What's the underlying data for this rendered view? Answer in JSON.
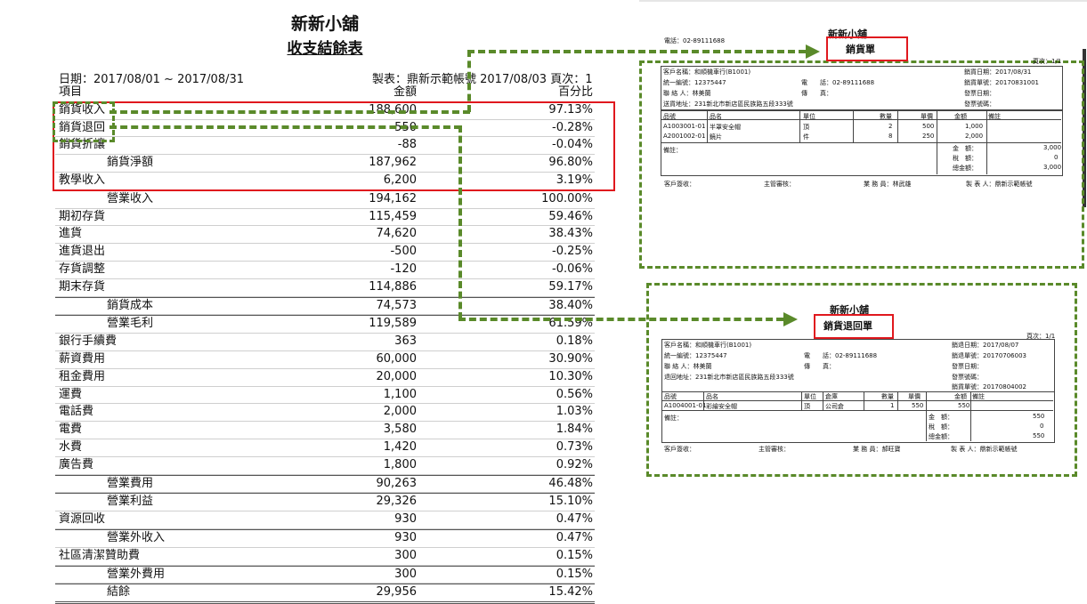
{
  "report": {
    "title": "新新小舖",
    "subtitle": "收支結餘表",
    "date_range": "日期：2017/08/01 ~ 2017/08/31",
    "made_by": "製表：鼎新示範帳號 2017/08/03 頁次：1",
    "headers": {
      "item": "項目",
      "amount": "金額",
      "percent": "百分比"
    },
    "rows": [
      {
        "name": "銷貨收入",
        "amount": "188,600",
        "pct": "97.13%",
        "indent": false
      },
      {
        "name": "銷貨退回",
        "amount": "-550",
        "pct": "-0.28%",
        "indent": false
      },
      {
        "name": "銷貨折讓",
        "amount": "-88",
        "pct": "-0.04%",
        "indent": false
      },
      {
        "name": "銷貨淨額",
        "amount": "187,962",
        "pct": "96.80%",
        "indent": true
      },
      {
        "name": "教學收入",
        "amount": "6,200",
        "pct": "3.19%",
        "indent": false
      },
      {
        "name": "營業收入",
        "amount": "194,162",
        "pct": "100.00%",
        "indent": true
      },
      {
        "name": "期初存貨",
        "amount": "115,459",
        "pct": "59.46%",
        "indent": false
      },
      {
        "name": "進貨",
        "amount": "74,620",
        "pct": "38.43%",
        "indent": false
      },
      {
        "name": "進貨退出",
        "amount": "-500",
        "pct": "-0.25%",
        "indent": false
      },
      {
        "name": "存貨調整",
        "amount": "-120",
        "pct": "-0.06%",
        "indent": false
      },
      {
        "name": "期末存貨",
        "amount": "114,886",
        "pct": "59.17%",
        "indent": false
      },
      {
        "name": "銷貨成本",
        "amount": "74,573",
        "pct": "38.40%",
        "indent": true
      },
      {
        "name": "營業毛利",
        "amount": "119,589",
        "pct": "61.59%",
        "indent": true
      },
      {
        "name": "銀行手續費",
        "amount": "363",
        "pct": "0.18%",
        "indent": false
      },
      {
        "name": "薪資費用",
        "amount": "60,000",
        "pct": "30.90%",
        "indent": false
      },
      {
        "name": "租金費用",
        "amount": "20,000",
        "pct": "10.30%",
        "indent": false
      },
      {
        "name": "運費",
        "amount": "1,100",
        "pct": "0.56%",
        "indent": false
      },
      {
        "name": "電話費",
        "amount": "2,000",
        "pct": "1.03%",
        "indent": false
      },
      {
        "name": "電費",
        "amount": "3,580",
        "pct": "1.84%",
        "indent": false
      },
      {
        "name": "水費",
        "amount": "1,420",
        "pct": "0.73%",
        "indent": false
      },
      {
        "name": "廣告費",
        "amount": "1,800",
        "pct": "0.92%",
        "indent": false
      },
      {
        "name": "營業費用",
        "amount": "90,263",
        "pct": "46.48%",
        "indent": true
      },
      {
        "name": "營業利益",
        "amount": "29,326",
        "pct": "15.10%",
        "indent": true
      },
      {
        "name": "資源回收",
        "amount": "930",
        "pct": "0.47%",
        "indent": false
      },
      {
        "name": "營業外收入",
        "amount": "930",
        "pct": "0.47%",
        "indent": true
      },
      {
        "name": "社區清潔贊助費",
        "amount": "300",
        "pct": "0.15%",
        "indent": false
      },
      {
        "name": "營業外費用",
        "amount": "300",
        "pct": "0.15%",
        "indent": true
      },
      {
        "name": "結餘",
        "amount": "29,956",
        "pct": "15.42%",
        "indent": true
      }
    ]
  },
  "sales_doc": {
    "store": "新新小舖",
    "type": "銷貨單",
    "phone": "電話：02-89111688",
    "customer": "客戶名稱：和順機車行(B1001)",
    "tax_id": "統一編號：12375447",
    "contact": "聯 絡 人：林美蘭",
    "address": "送貨地址：231新北市新店區民族路五段333號",
    "phone2_label": "電　　話：02-89111688",
    "fax_label": "傳　　真：",
    "date": "銷貨日期：2017/08/31",
    "doc_no": "銷貨單號：20170831001",
    "invoice_date": "發票日期：",
    "invoice_no": "發票號碼：",
    "cols": [
      "品號",
      "品名",
      "單位",
      "數量",
      "單價",
      "金額",
      "備註"
    ],
    "items": [
      [
        "A1003001-01",
        "半罩安全帽",
        "頂",
        "2",
        "500",
        "1,000"
      ],
      [
        "A2001002-01",
        "鏡片",
        "件",
        "8",
        "250",
        "2,000"
      ]
    ],
    "note": "備註：",
    "totals": [
      [
        "金　額：",
        "3,000"
      ],
      [
        "稅　額：",
        "0"
      ],
      [
        "總金額：",
        "3,000"
      ]
    ],
    "signs": [
      "客戶簽收：",
      "主管審核：",
      "業 務 員：林武雄",
      "製 表 人：鼎新示範帳號"
    ],
    "page": "頁次：1/1"
  },
  "return_doc": {
    "store": "新新小舖",
    "type": "銷貨退回單",
    "page": "頁次：1/1",
    "customer": "客戶名稱：和順機車行(B1001)",
    "tax_id": "統一編號：12375447",
    "contact": "聯 絡 人：林美蘭",
    "address": "退回地址：231新北市新店區民族路五段333號",
    "phone_label": "電　　話：02-89111688",
    "fax_label": "傳　　真：",
    "date": "銷退日期：2017/08/07",
    "doc_no": "銷退單號：20170706003",
    "invoice_date": "發票日期：",
    "invoice_no": "發票號碼：",
    "sales_no": "銷貨單號：20170804002",
    "cols": [
      "品號",
      "品名",
      "單位",
      "倉庫",
      "數量",
      "單價",
      "金額",
      "備註"
    ],
    "items": [
      [
        "A1004001-01",
        "彩繪安全帽",
        "頂",
        "公司倉",
        "1",
        "550",
        "550"
      ]
    ],
    "note": "備註：",
    "totals": [
      [
        "金　額：",
        "550"
      ],
      [
        "稅　額：",
        "0"
      ],
      [
        "總金額：",
        "550"
      ]
    ],
    "signs": [
      "客戶簽收：",
      "主管審核：",
      "業 務 員：郝旺寶",
      "製 表 人：鼎新示範帳號"
    ]
  },
  "colors": {
    "red": "#e0181e",
    "green": "#5a8a2a"
  }
}
